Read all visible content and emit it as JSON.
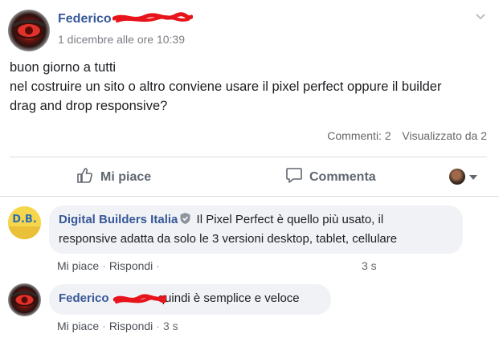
{
  "post": {
    "author": "Federico",
    "timestamp": "1 dicembre alle ore 10:39",
    "text_line1": "buon giorno a tutti",
    "text_line2": "nel costruire un sito o altro conviene usare il pixel perfect oppure il builder",
    "text_line3": "drag and drop responsive?",
    "stats": {
      "comments": "Commenti: 2",
      "views": "Visualizzato da 2"
    },
    "actions": {
      "like": "Mi piace",
      "comment": "Commenta"
    }
  },
  "comments": [
    {
      "author": "Digital Builders Italia",
      "avatar_text": "D.B.",
      "text_line1": "Il Pixel Perfect è quello più usato, il",
      "text_line2": "responsive adatta da solo le 3 versioni desktop, tablet, cellulare",
      "like": "Mi piace",
      "reply": "Rispondi",
      "sep": "·",
      "time": "3 s"
    },
    {
      "author": "Federico",
      "text": "quindi è semplice e veloce",
      "like": "Mi piace",
      "reply": "Rispondi",
      "sep": "·",
      "time": "3 s"
    }
  ],
  "colors": {
    "author": "#385898",
    "bubble": "#f0f2f5",
    "scribble": "#e8141b"
  }
}
